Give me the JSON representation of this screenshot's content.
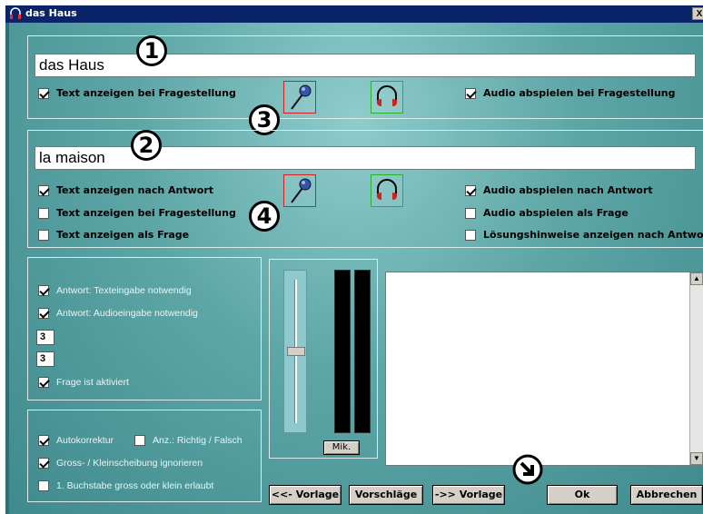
{
  "window": {
    "title": "das Haus",
    "close_label": "X"
  },
  "question": {
    "text": "das Haus",
    "cb_text_on_question": {
      "label": "Text anzeigen bei Fragestellung",
      "checked": true
    },
    "cb_audio_on_question": {
      "label": "Audio abspielen bei Fragestellung",
      "checked": true
    }
  },
  "answer": {
    "text": "la maison",
    "cb_text_after_answer": {
      "label": "Text anzeigen nach Antwort",
      "checked": true
    },
    "cb_text_on_question": {
      "label": "Text anzeigen bei Fragestellung",
      "checked": false
    },
    "cb_text_as_question": {
      "label": "Text anzeigen als Frage",
      "checked": false
    },
    "cb_audio_after_answer": {
      "label": "Audio abspielen nach Antwort",
      "checked": true
    },
    "cb_audio_as_question": {
      "label": "Audio abspielen als Frage",
      "checked": false
    },
    "cb_hints_after_answer": {
      "label": "Lösungshinweise anzeigen nach Antwort",
      "checked": false
    }
  },
  "badges": {
    "b1": "1",
    "b2": "2",
    "b3": "3",
    "b4": "4"
  },
  "options": {
    "cb_text_input_required": {
      "label": "Antwort: Texteingabe notwendig",
      "checked": true
    },
    "cb_audio_input_required": {
      "label": "Antwort: Audioeingabe notwendig",
      "checked": true
    },
    "num1": "3",
    "num2": "3",
    "cb_question_active": {
      "label": "Frage ist aktiviert",
      "checked": true
    }
  },
  "correction": {
    "cb_autocorrect": {
      "label": "Autokorrektur",
      "checked": true
    },
    "cb_show_right_wrong": {
      "label": "Anz.: Richtig / Falsch",
      "checked": false
    },
    "cb_ignore_case": {
      "label": "Gross- / Kleinscheibung ignorieren",
      "checked": true
    },
    "cb_first_letter": {
      "label": "1. Buchstabe gross oder klein erlaubt",
      "checked": false
    }
  },
  "audio": {
    "mic_label": "Mik."
  },
  "buttons": {
    "prev_template": "<<- Vorlage",
    "suggestions": "Vorschläge",
    "next_template": "->> Vorlage",
    "ok": "Ok",
    "cancel": "Abbrechen"
  },
  "colors": {
    "title_bar": "#0a246a",
    "client_teal": "#5ea6a6",
    "mic_border": "#d02020",
    "headphone_border": "#2ab02a"
  },
  "icons": [
    "headphones-icon",
    "microphone-icon",
    "arrow-down-right-icon"
  ]
}
